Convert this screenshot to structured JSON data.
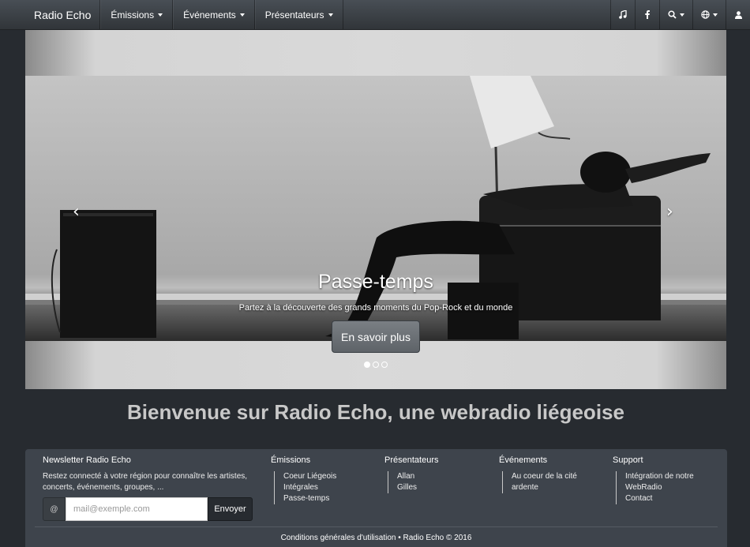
{
  "navbar": {
    "brand": "Radio Echo",
    "menus": [
      {
        "label": "Émissions"
      },
      {
        "label": "Événements"
      },
      {
        "label": "Présentateurs"
      }
    ],
    "icons": [
      "music-icon",
      "facebook-icon",
      "search-icon",
      "globe-icon",
      "user-icon"
    ]
  },
  "carousel": {
    "prev_glyph": "‹",
    "next_glyph": "›",
    "title": "Passe-temps",
    "subtitle": "Partez à la découverte des grands moments du Pop-Rock et du monde",
    "button": "En savoir plus",
    "slide_count": 3,
    "active_slide": 1
  },
  "welcome": "Bienvenue sur Radio Echo, une webradio liégeoise",
  "footer": {
    "newsletter": {
      "title": "Newsletter Radio Echo",
      "desc": "Restez connecté à votre région pour connaître les artistes, concerts, événements, groupes, ...",
      "at": "@",
      "placeholder": "mail@exemple.com",
      "send": "Envoyer"
    },
    "columns": [
      {
        "title": "Émissions",
        "items": [
          "Coeur Liégeois",
          "Intégrales",
          "Passe-temps"
        ]
      },
      {
        "title": "Présentateurs",
        "items": [
          "Allan",
          "Gilles"
        ]
      },
      {
        "title": "Événements",
        "items": [
          "Au coeur de la cité ardente"
        ]
      },
      {
        "title": "Support",
        "items": [
          "Intégration de notre WebRadio",
          "Contact"
        ]
      }
    ],
    "bottom": "Conditions générales d'utilisation • Radio Echo © 2016"
  }
}
